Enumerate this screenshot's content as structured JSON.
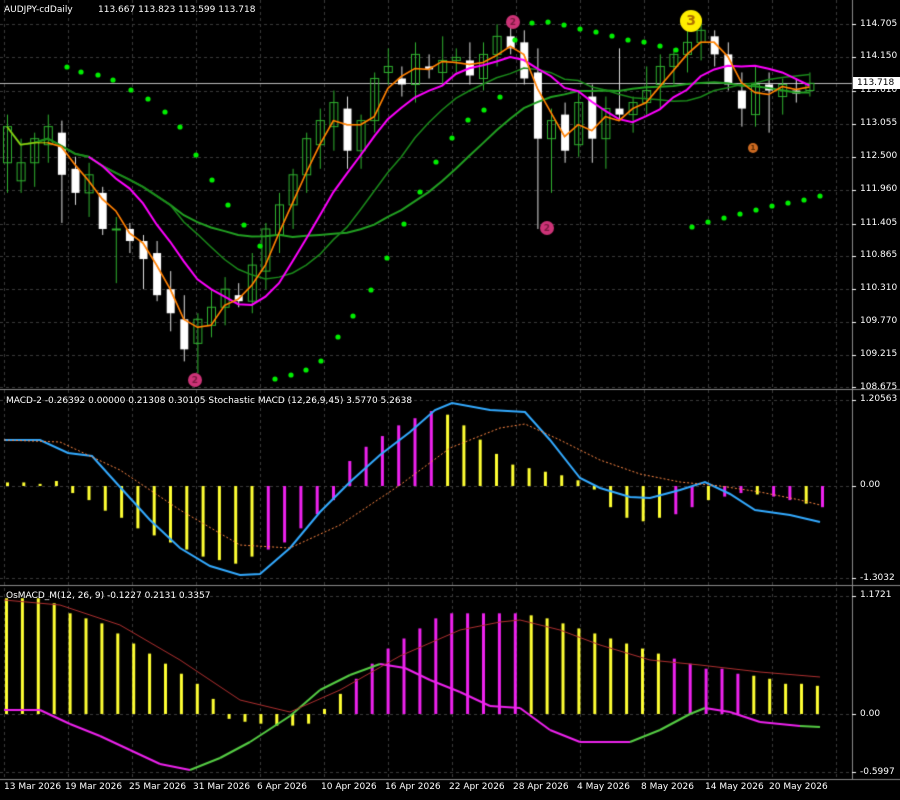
{
  "window": {
    "symbol_title": "AUDJPY-cdDaily",
    "ohlc": "113.667 113.823 113.599 113.718",
    "current_price": "113.718"
  },
  "colors": {
    "background": "#000000",
    "grid": "#3a3a3a",
    "bull_candle": "#1a8a1a",
    "bear_candle": "#ffffff",
    "ma_fast": "#ffff00",
    "ma_mid": "#ff0000",
    "ma_slow": "#ff00ff",
    "ma_green": "#22a022",
    "sar": "#00ee00",
    "histogram_yellow": "#ffff33",
    "histogram_magenta": "#ee22ee",
    "macd_line": "#33aaff",
    "signal_line": "#ff8844"
  },
  "main_panel": {
    "price_axis": [
      "114.705",
      "114.150",
      "113.610",
      "113.055",
      "112.500",
      "111.960",
      "111.405",
      "110.865",
      "110.310",
      "109.770",
      "109.215",
      "108.675"
    ],
    "markers": [
      {
        "label": "2",
        "kind": "pink-circle-top"
      },
      {
        "label": "2",
        "kind": "pink-circle-bottom"
      },
      {
        "label": "2",
        "kind": "pink-circle-low"
      },
      {
        "label": "3",
        "kind": "yellow-circle"
      },
      {
        "label": "1",
        "kind": "orange-circle"
      }
    ]
  },
  "macd_panel": {
    "title": "MACD-2 -0.26392 0.00000 0.21308 0.30105  Stochastic MACD (12,26,9,45) 3.5770 5.2638",
    "axis": [
      "1.20563",
      "0.00",
      "-1.3032"
    ]
  },
  "osmacd_panel": {
    "title": "OsMACD_M(12, 26, 9) -0.1227 0.2131 0.3357",
    "axis": [
      "1.1721",
      "0.00",
      "-0.5997"
    ]
  },
  "time_axis": [
    "13 Mar 2026",
    "19 Mar 2026",
    "25 Mar 2026",
    "31 Mar 2026",
    "6 Apr 2026",
    "10 Apr 2026",
    "16 Apr 2026",
    "22 Apr 2026",
    "28 Apr 2026",
    "4 May 2026",
    "8 May 2026",
    "14 May 2026",
    "20 May 2026"
  ]
}
